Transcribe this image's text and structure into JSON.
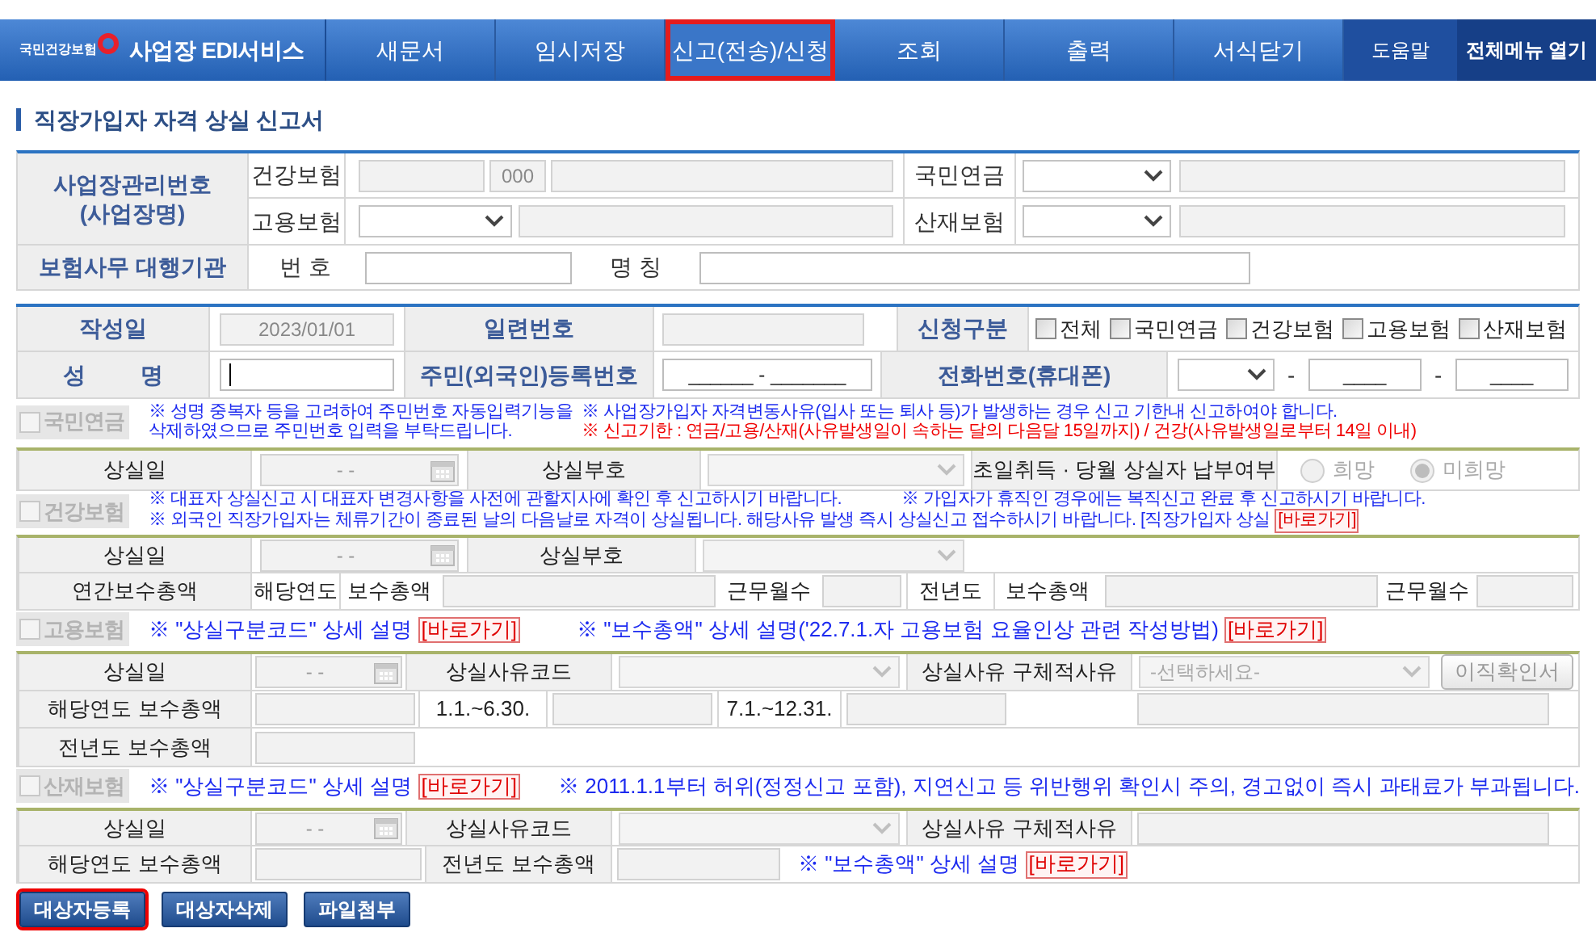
{
  "header": {
    "logo_text": "국민건강보험",
    "service_name": "사업장 EDI서비스",
    "menu": [
      {
        "label": "새문서",
        "selected": false
      },
      {
        "label": "임시저장",
        "selected": false
      },
      {
        "label": "신고(전송)/신청",
        "selected": true
      },
      {
        "label": "조회",
        "selected": false
      },
      {
        "label": "출력",
        "selected": false
      },
      {
        "label": "서식닫기",
        "selected": false
      }
    ],
    "help": "도움말",
    "all_menu": "전체메뉴 열기"
  },
  "page_title": "직장가입자 자격 상실 신고서",
  "workplace": {
    "id_label_lines": [
      "사업장관리번호",
      "(사업장명)"
    ],
    "rows": [
      [
        {
          "kind": "text",
          "text": "건강보험"
        },
        {
          "kind": "field",
          "disabled": true
        },
        {
          "kind": "field",
          "value": "000",
          "disabled": true
        },
        {
          "kind": "field",
          "disabled": true
        },
        {
          "kind": "text",
          "text": "국민연금"
        },
        {
          "kind": "select"
        },
        {
          "kind": "field",
          "disabled": true
        }
      ],
      [
        {
          "kind": "text",
          "text": "고용보험"
        },
        {
          "kind": "select"
        },
        {
          "kind": "field",
          "disabled": true
        },
        {
          "kind": "text",
          "text": "산재보험"
        },
        {
          "kind": "select"
        },
        {
          "kind": "field",
          "disabled": true
        }
      ]
    ],
    "agency_label": "보험사무 대행기관",
    "agency_row": [
      {
        "kind": "text",
        "text": "번 호"
      },
      {
        "kind": "field",
        "disabled": false
      },
      {
        "kind": "text",
        "text": "명 칭"
      },
      {
        "kind": "field",
        "disabled": false
      }
    ]
  },
  "applicant": {
    "rows": [
      [
        {
          "kind": "label",
          "text": "작성일"
        },
        {
          "kind": "field",
          "value": "2023/01/01",
          "disabled": true
        },
        {
          "kind": "label",
          "text": "일련번호"
        },
        {
          "kind": "field",
          "disabled": true
        },
        {
          "kind": "label",
          "text": "신청구분"
        },
        {
          "kind": "checks",
          "options": [
            {
              "label": "전체",
              "checked": false
            },
            {
              "label": "국민연금",
              "checked": false
            },
            {
              "label": "건강보험",
              "checked": false
            },
            {
              "label": "고용보험",
              "checked": false
            },
            {
              "label": "산재보험",
              "checked": false
            }
          ]
        }
      ],
      [
        {
          "kind": "label",
          "text": "성 명"
        },
        {
          "kind": "field",
          "disabled": false,
          "focused": true
        },
        {
          "kind": "label",
          "text": "주민(외국인)등록번호"
        },
        {
          "kind": "field",
          "value": "______ - _______",
          "disabled": false
        },
        {
          "kind": "label",
          "text": "전화번호(휴대폰)"
        },
        {
          "kind": "group",
          "items": [
            {
              "kind": "select"
            },
            {
              "kind": "text",
              "text": "-"
            },
            {
              "kind": "field",
              "value": "____",
              "disabled": false
            },
            {
              "kind": "text",
              "text": "-"
            },
            {
              "kind": "field",
              "value": "____",
              "disabled": false
            }
          ]
        }
      ]
    ]
  },
  "pension": {
    "label": "국민연금",
    "checked": false,
    "disabled": true,
    "notes": [
      {
        "lines": [
          "※ 성명 중복자 등을 고려하여 주민번호 자동입력기능을",
          "삭제하였으므로 주민번호 입력을 부탁드립니다."
        ],
        "color": "#1d2bf0"
      },
      {
        "text": "※ 사업장가입자 자격변동사유(입사 또는 퇴사 등)가 발생하는 경우 신고 기한내 신고하여야 합니다.",
        "color": "#1d2bf0"
      },
      {
        "text": "※ 신고기한 : 연금/고용/산재(사유발생일이 속하는 달의 다음달 15일까지) / 건강(사유발생일로부터 14일 이내)",
        "color": "#f00000"
      }
    ],
    "rows": [
      [
        {
          "kind": "label",
          "text": "상실일"
        },
        {
          "kind": "date",
          "mask": "- -"
        },
        {
          "kind": "label",
          "text": "상실부호"
        },
        {
          "kind": "select"
        },
        {
          "kind": "label",
          "text": "초일취득 · 당월 상실자 납부여부"
        },
        {
          "kind": "radios",
          "options": [
            {
              "label": "희망",
              "selected": false
            },
            {
              "label": "미희망",
              "selected": true
            }
          ]
        }
      ]
    ]
  },
  "health": {
    "label": "건강보험",
    "checked": false,
    "disabled": true,
    "notes": [
      {
        "text": "※ 대표자 상실신고 시 대표자 변경사항을 사전에 관할지사에 확인 후 신고하시기 바랍니다."
      },
      {
        "text": "※ 가입자가 휴직인 경우에는 복직신고 완료 후 신고하시기 바랍니다."
      },
      {
        "text": "※ 외국인 직장가입자는 체류기간이 종료된 날의 다음날로 자격이 상실됩니다. 해당사유 발생 즉시 상실신고 접수하시기 바랍니다. [직장가입자 상실",
        "link": "[바로가기]"
      }
    ],
    "rows": [
      [
        {
          "kind": "label",
          "text": "상실일"
        },
        {
          "kind": "date",
          "mask": "- -"
        },
        {
          "kind": "label",
          "text": "상실부호"
        },
        {
          "kind": "select"
        }
      ],
      [
        {
          "kind": "label",
          "text": "연간보수총액"
        },
        {
          "kind": "text",
          "text": "해당연도"
        },
        {
          "kind": "text",
          "text": "보수총액"
        },
        {
          "kind": "field"
        },
        {
          "kind": "text",
          "text": "근무월수"
        },
        {
          "kind": "field"
        },
        {
          "kind": "text",
          "text": "전년도"
        },
        {
          "kind": "text",
          "text": "보수총액"
        },
        {
          "kind": "field"
        },
        {
          "kind": "text",
          "text": "근무월수"
        },
        {
          "kind": "field"
        }
      ]
    ]
  },
  "employment": {
    "label": "고용보험",
    "checked": false,
    "disabled": true,
    "notes": [
      {
        "text": "※ \"상실구분코드\" 상세 설명",
        "link": "[바로가기]"
      },
      {
        "text": "※ \"보수총액\" 상세 설명('22.7.1.자 고용보험 요율인상 관련 작성방법)",
        "link": "[바로가기]"
      }
    ],
    "rows": [
      [
        {
          "kind": "label",
          "text": "상실일"
        },
        {
          "kind": "date",
          "mask": "- -"
        },
        {
          "kind": "label",
          "text": "상실사유코드"
        },
        {
          "kind": "select"
        },
        {
          "kind": "label",
          "text": "상실사유 구체적사유"
        },
        {
          "kind": "select",
          "value": "-선택하세요-"
        },
        {
          "kind": "button",
          "label": "이직확인서"
        }
      ],
      [
        {
          "kind": "label",
          "text": "해당연도 보수총액"
        },
        {
          "kind": "field"
        },
        {
          "kind": "text",
          "text": "1.1.~6.30."
        },
        {
          "kind": "field"
        },
        {
          "kind": "text",
          "text": "7.1.~12.31."
        },
        {
          "kind": "field"
        },
        {
          "kind": "field"
        }
      ],
      [
        {
          "kind": "label",
          "text": "전년도 보수총액"
        },
        {
          "kind": "field"
        }
      ]
    ]
  },
  "accident": {
    "label": "산재보험",
    "checked": false,
    "disabled": true,
    "notes": [
      {
        "text": "※ \"상실구분코드\" 상세 설명",
        "link": "[바로가기]"
      },
      {
        "text": "※ 2011.1.1부터 허위(정정신고 포함), 지연신고 등 위반행위 확인시 주의, 경고없이 즉시 과태료가 부과됩니다."
      }
    ],
    "rows": [
      [
        {
          "kind": "label",
          "text": "상실일"
        },
        {
          "kind": "date",
          "mask": "- -"
        },
        {
          "kind": "label",
          "text": "상실사유코드"
        },
        {
          "kind": "select"
        },
        {
          "kind": "label",
          "text": "상실사유 구체적사유"
        },
        {
          "kind": "field"
        }
      ],
      [
        {
          "kind": "label",
          "text": "해당연도 보수총액"
        },
        {
          "kind": "field"
        },
        {
          "kind": "label",
          "text": "전년도 보수총액"
        },
        {
          "kind": "field"
        },
        {
          "kind": "note",
          "text": "※ \"보수총액\" 상세 설명",
          "link": "[바로가기]"
        }
      ]
    ]
  },
  "buttons": [
    {
      "label": "대상자등록",
      "selected": true
    },
    {
      "label": "대상자삭제",
      "selected": false
    },
    {
      "label": "파일첨부",
      "selected": false
    }
  ]
}
